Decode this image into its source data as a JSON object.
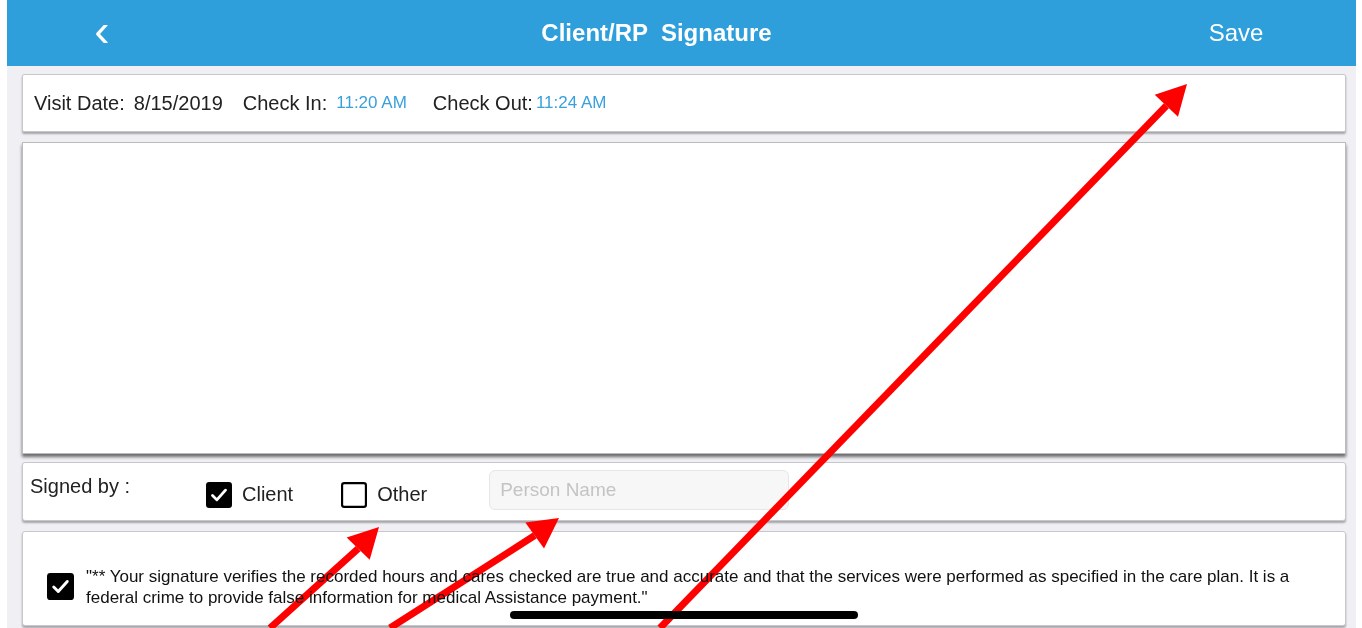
{
  "header": {
    "back": "‹",
    "title": "Client/RP  Signature",
    "action": "Save"
  },
  "visit": [
    {
      "kind": "plain",
      "label": "Visit Date:",
      "value": "8/15/2019"
    },
    {
      "kind": "time",
      "label": "Check In:",
      "value": "11:20 AM"
    },
    {
      "kind": "time",
      "label": "Check Out:",
      "value": "11:24 AM"
    }
  ],
  "signed_by": {
    "label": "Signed by :",
    "options": [
      {
        "label": "Client",
        "checked": true
      },
      {
        "label": "Other",
        "checked": false
      }
    ],
    "name_field": {
      "placeholder": "Person Name"
    }
  },
  "attestation": {
    "checked": true,
    "text": "\"** Your signature verifies the recorded hours and cares checked are true and accurate and that the services were performed as specified in the care plan. It is a federal crime to provide false information for medical Assistance payment.\""
  }
}
